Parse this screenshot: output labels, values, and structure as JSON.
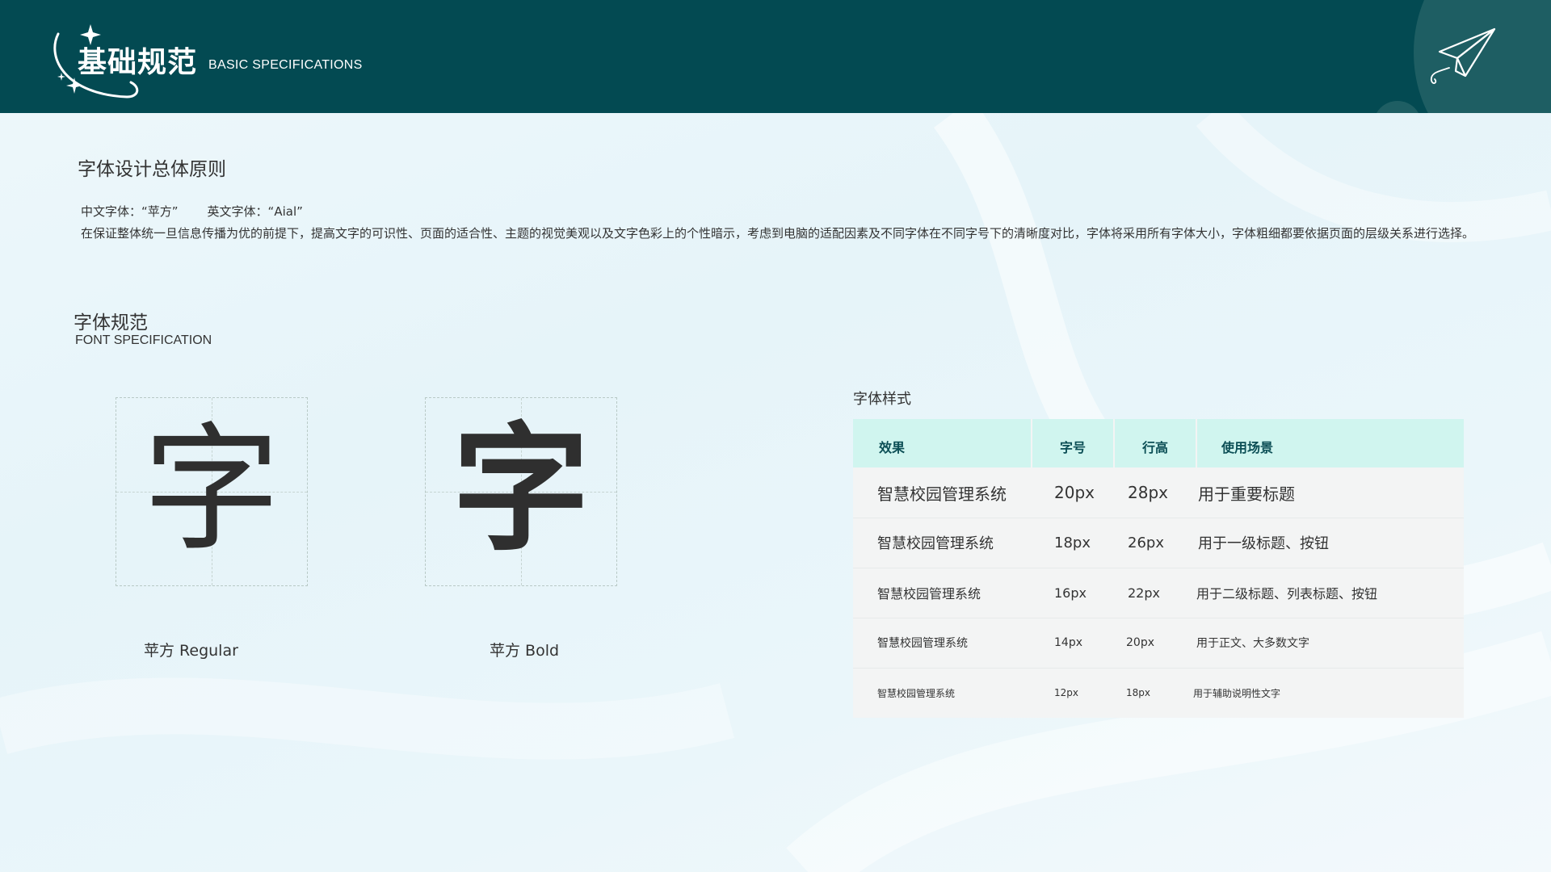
{
  "header": {
    "title": "基础规范",
    "subtitle": "BASIC SPECIFICATIONS"
  },
  "principles": {
    "title": "字体设计总体原则",
    "cn_font": "中文字体：“苹方”",
    "en_font": "英文字体：“Aial”",
    "description": "在保证整体统一旦信息传播为优的前提下，提高文字的可识性、页面的适合性、主题的视觉美观以及文字色彩上的个性暗示，考虑到电脑的适配因素及不同字体在不同字号下的清晰度对比，字体将采用所有字体大小，字体粗细都要依据页面的层级关系进行选择。"
  },
  "font_spec": {
    "title": "字体规范",
    "subtitle": "FONT SPECIFICATION",
    "glyph": "字",
    "regular_caption": "苹方 Regular",
    "bold_caption": "苹方 Bold"
  },
  "font_styles": {
    "label": "字体样式",
    "headers": [
      "效果",
      "字号",
      "行高",
      "使用场景"
    ],
    "rows": [
      {
        "effect": "智慧校园管理系统",
        "size": "20px",
        "line_height": "28px",
        "usage": "用于重要标题"
      },
      {
        "effect": "智慧校园管理系统",
        "size": "18px",
        "line_height": "26px",
        "usage": "用于一级标题、按钮"
      },
      {
        "effect": "智慧校园管理系统",
        "size": "16px",
        "line_height": "22px",
        "usage": "用于二级标题、列表标题、按钮"
      },
      {
        "effect": "智慧校园管理系统",
        "size": "14px",
        "line_height": "20px",
        "usage": "用于正文、大多数文字"
      },
      {
        "effect": "智慧校园管理系统",
        "size": "12px",
        "line_height": "18px",
        "usage": "用于辅助说明性文字"
      }
    ]
  },
  "colors": {
    "header_bg": "#034a52",
    "table_header_bg": "#d0f5ef",
    "table_header_text": "#0b4e55"
  }
}
